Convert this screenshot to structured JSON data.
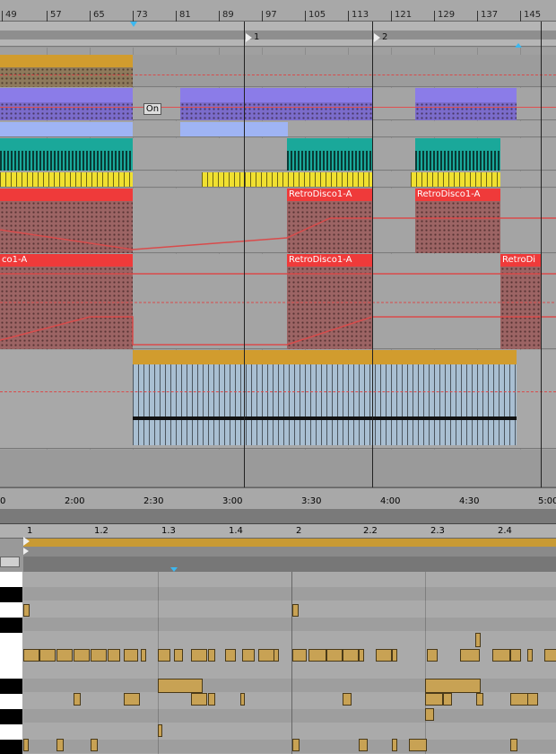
{
  "arrangement": {
    "bar_numbers": [
      "49",
      "57",
      "65",
      "73",
      "81",
      "89",
      "97",
      "105",
      "113",
      "121",
      "129",
      "137",
      "145"
    ],
    "locators": [
      "1",
      "2"
    ],
    "time_labels": [
      "0",
      "2:00",
      "2:30",
      "3:00",
      "3:30",
      "4:00",
      "4:30",
      "5:00"
    ],
    "clip_labels": {
      "retro_a": "RetroDisco1-A",
      "retro_b": "RetroDisco1-A",
      "retro_c": "co1-A",
      "retro_d": "RetroDisco1-A",
      "retro_e": "RetroDi"
    },
    "on_badge": "On"
  },
  "editor": {
    "beat_labels": [
      "1",
      "1.2",
      "1.3",
      "1.4",
      "2",
      "2.2",
      "2.3",
      "2.4"
    ]
  },
  "colors": {
    "orange": "#d19c2e",
    "purple": "#8b7ce8",
    "light_blue": "#9fb4f4",
    "teal": "#1aa89a",
    "yellow": "#f0e030",
    "red": "#ef3a3a",
    "note": "#c8a254"
  }
}
